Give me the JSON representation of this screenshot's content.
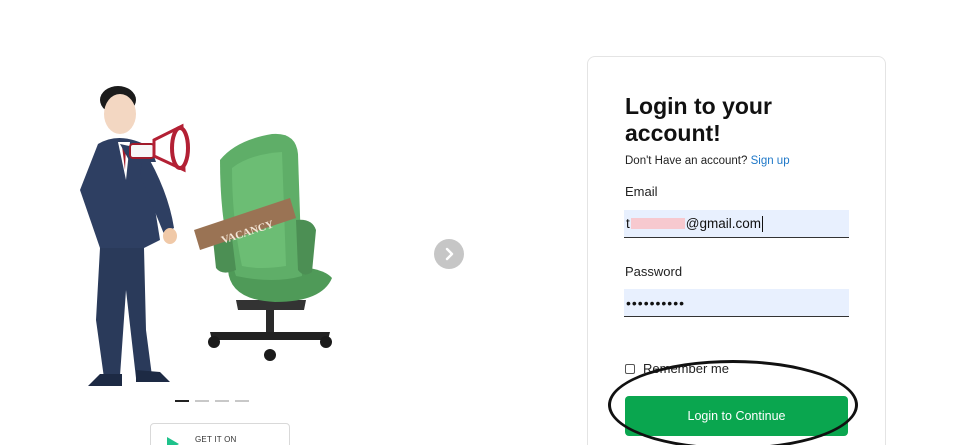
{
  "login": {
    "title": "Login to your account!",
    "signup_prompt": "Don't Have an account?",
    "signup_link": "Sign up",
    "email_label": "Email",
    "email_value_start": "t",
    "email_value_end": "@gmail.com",
    "password_label": "Password",
    "password_value": "••••••••••",
    "remember_label": "Remember me",
    "submit_label": "Login to Continue"
  },
  "illustration": {
    "sign_text": "VACANCY"
  },
  "store_badge": {
    "text": "GET IT ON"
  },
  "carousel": {
    "slides": 4,
    "active_index": 0
  },
  "colors": {
    "primary_button": "#0aa64f",
    "link": "#1f78c8",
    "autofill_field": "#e8f0fe"
  }
}
